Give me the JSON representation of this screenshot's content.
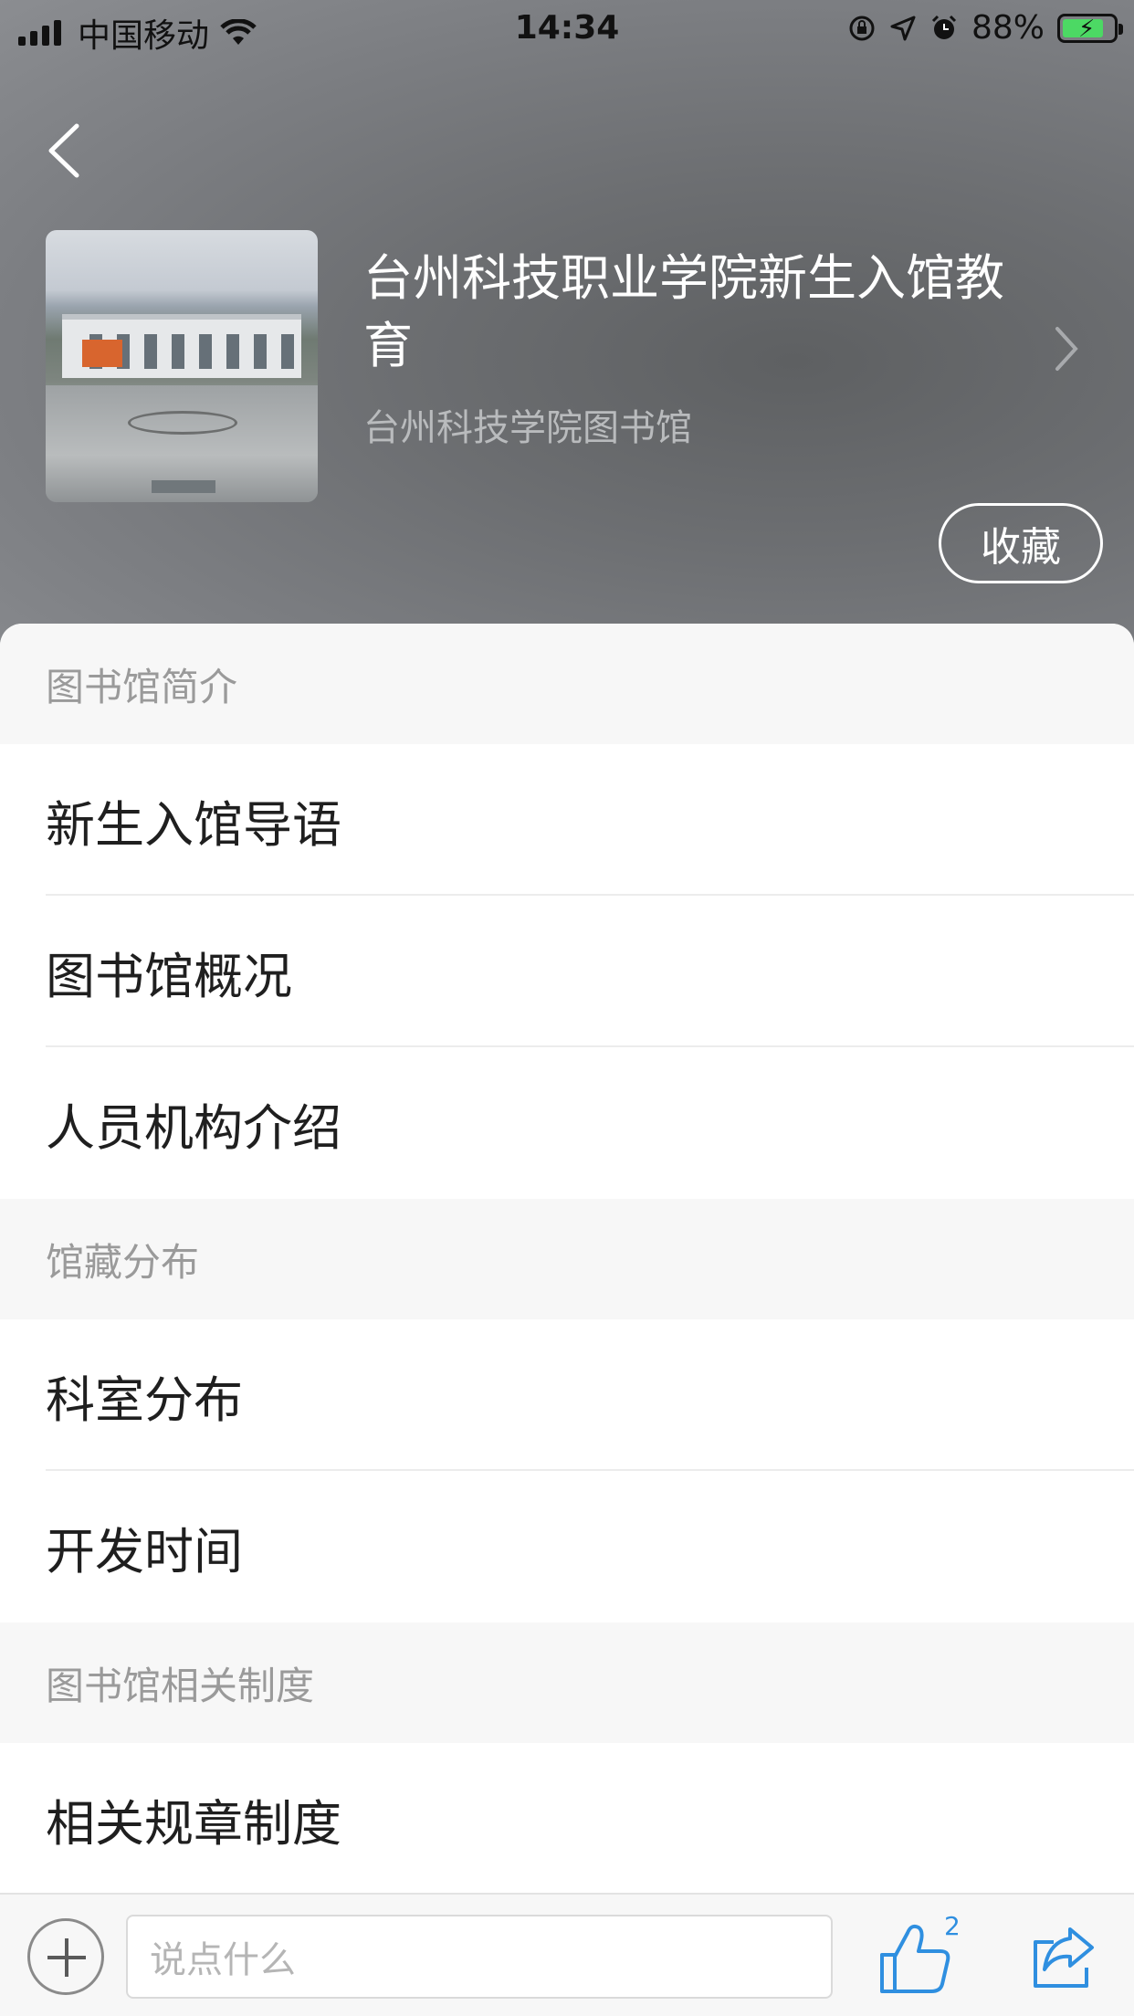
{
  "status_bar": {
    "carrier": "中国移动",
    "time": "14:34",
    "battery": "88%",
    "battery_level": 0.88
  },
  "header": {
    "title": "台州科技职业学院新生入馆教育",
    "subtitle": "台州科技学院图书馆",
    "favorite_label": "收藏",
    "cover_icon": "campus-photo"
  },
  "sections": [
    {
      "header": "图书馆简介",
      "items": [
        "新生入馆导语",
        "图书馆概况",
        "人员机构介绍"
      ]
    },
    {
      "header": "馆藏分布",
      "items": [
        "科室分布",
        "开发时间"
      ]
    },
    {
      "header": "图书馆相关制度",
      "items": [
        "相关规章制度"
      ]
    }
  ],
  "bottom_bar": {
    "comment_placeholder": "说点什么",
    "like_count": "2",
    "icons": [
      "plus-icon",
      "thumbs-up-icon",
      "share-icon"
    ]
  },
  "colors": {
    "accent": "#2f8fe0",
    "header_bg": "#6c6e71",
    "section_bg": "#f7f7f7"
  }
}
